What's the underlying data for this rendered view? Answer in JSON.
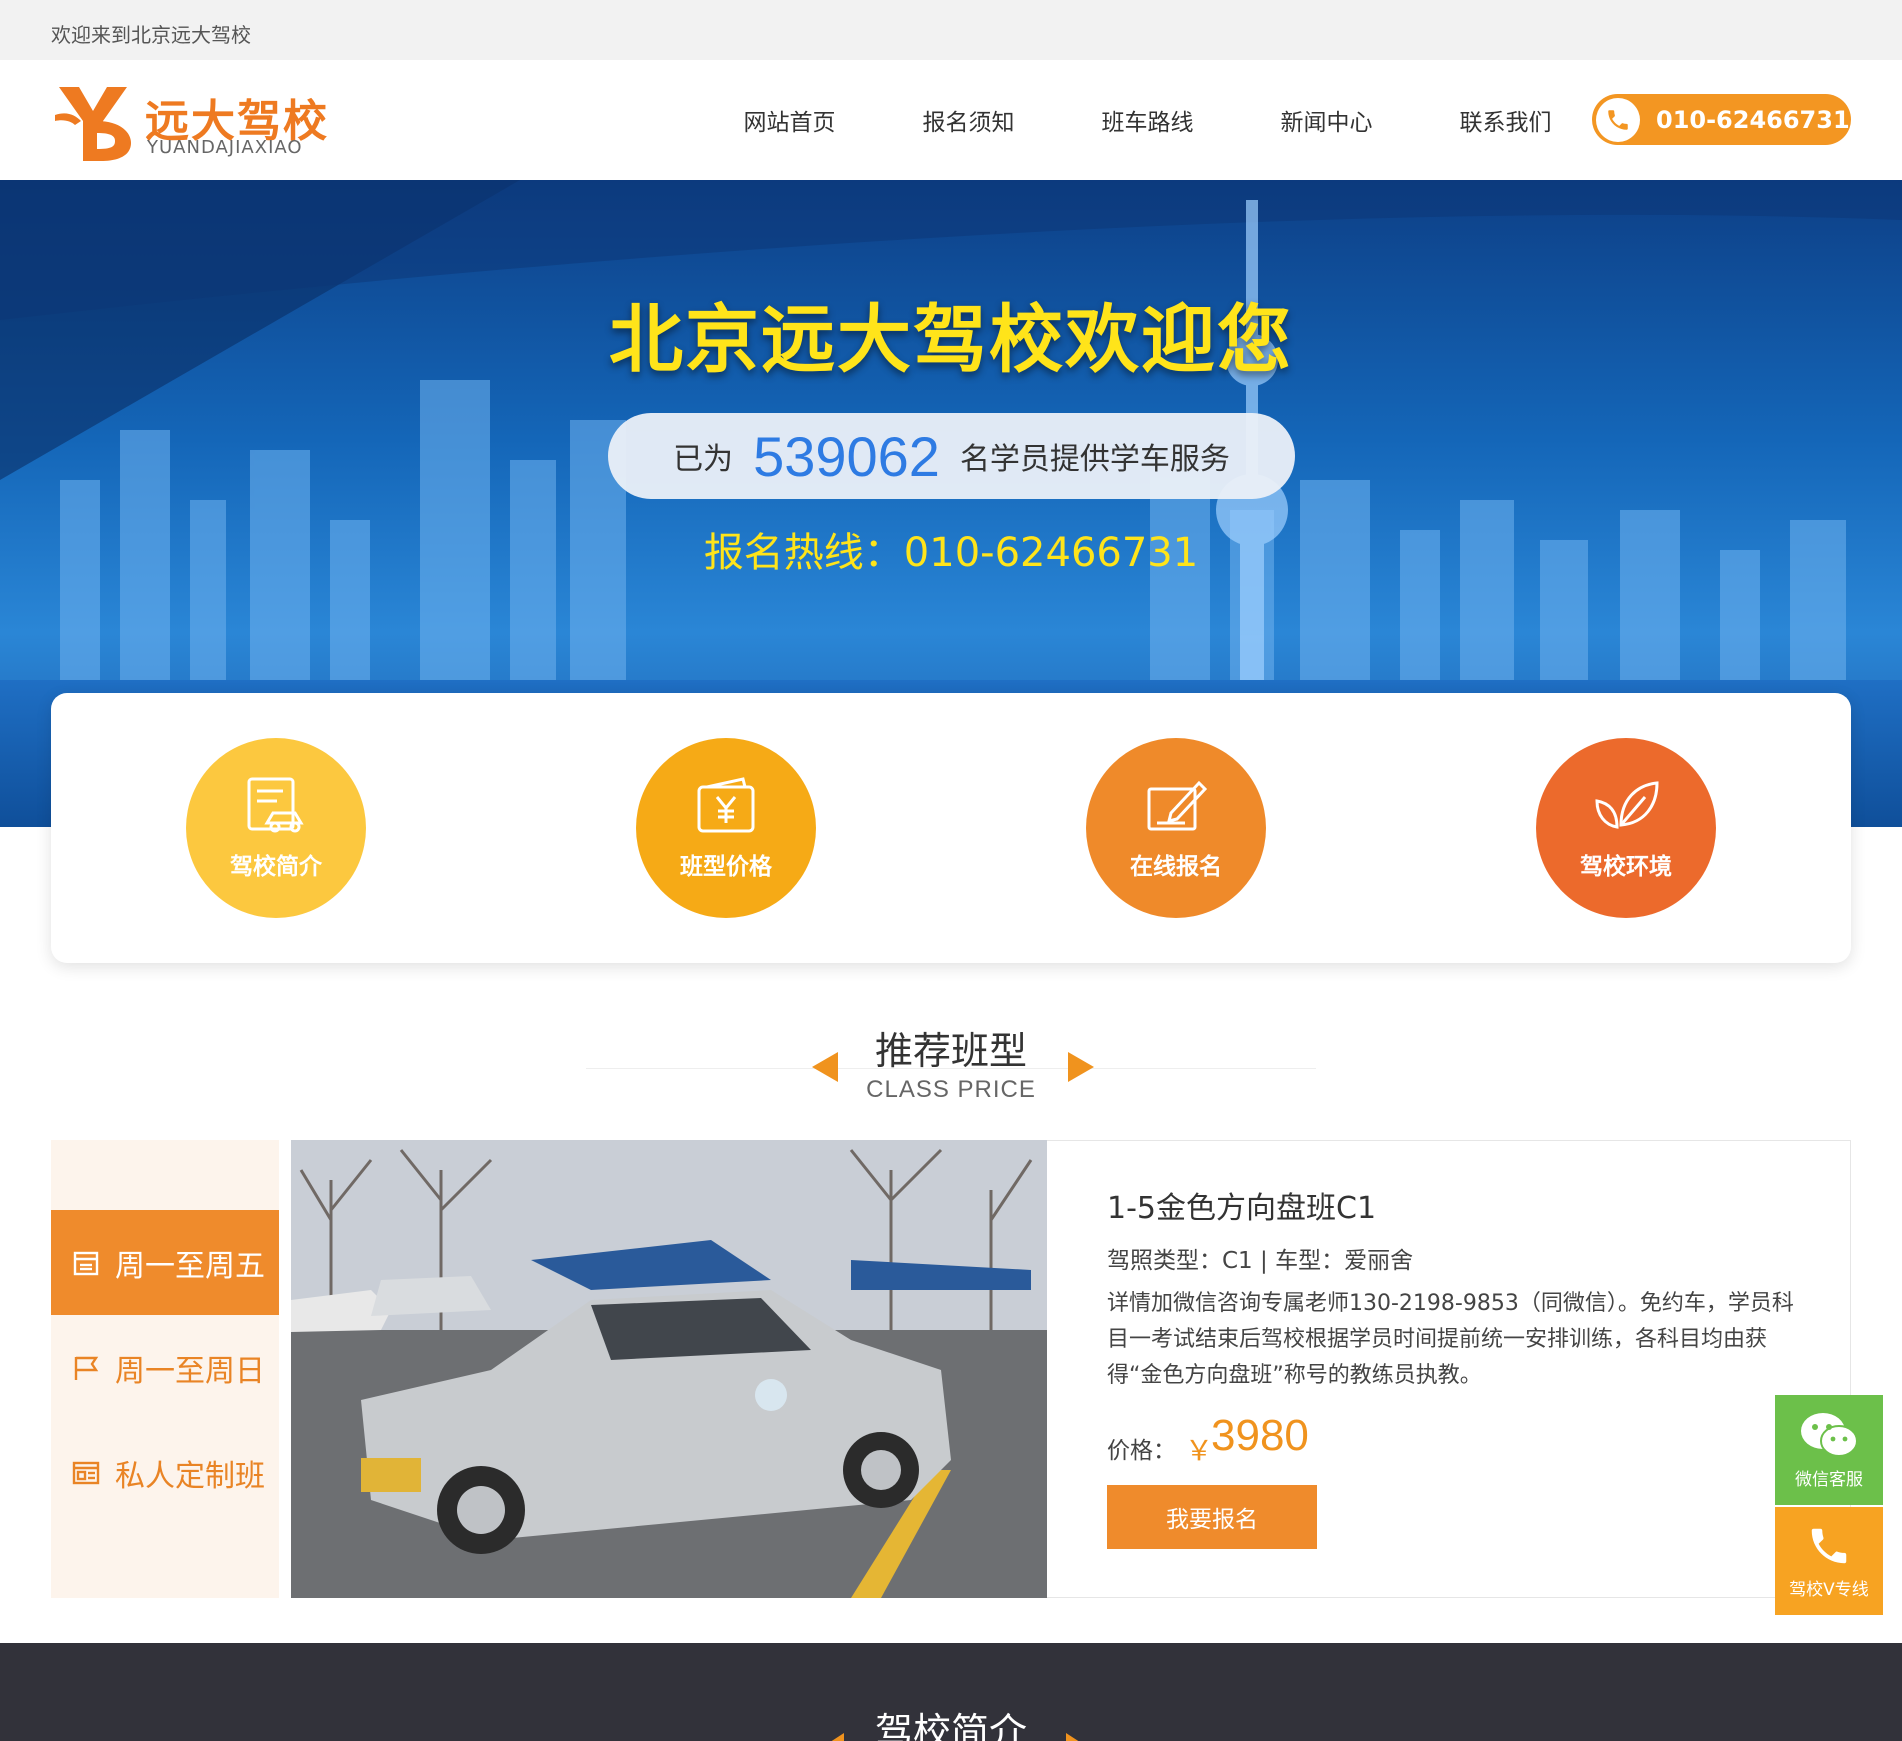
{
  "topbar": {
    "welcome": "欢迎来到北京远大驾校"
  },
  "logo": {
    "cn": "远大驾校",
    "en": "YUANDAJIAXIAO"
  },
  "nav": {
    "items": [
      "网站首页",
      "报名须知",
      "班车路线",
      "新闻中心",
      "联系我们"
    ]
  },
  "header_phone": {
    "number": "010-62466731",
    "icon": "phone-icon"
  },
  "banner": {
    "title": "北京远大驾校欢迎您",
    "counter_pre": "已为",
    "counter_value": "539062",
    "counter_post": "名学员提供学车服务",
    "hotline": "报名热线：010-62466731"
  },
  "features": [
    {
      "label": "驾校简介",
      "icon": "school-intro-icon",
      "color": "#fcc83f"
    },
    {
      "label": "班型价格",
      "icon": "price-tag-icon",
      "color": "#f6aa16"
    },
    {
      "label": "在线报名",
      "icon": "edit-form-icon",
      "color": "#ef8a2a"
    },
    {
      "label": "驾校环境",
      "icon": "leaf-icon",
      "color": "#ec6a2c"
    }
  ],
  "section": {
    "title": "推荐班型",
    "subtitle": "CLASS PRICE"
  },
  "tabs": [
    {
      "label": "周一至周五",
      "icon": "calendar-icon",
      "active": true
    },
    {
      "label": "周一至周日",
      "icon": "flag-icon",
      "active": false
    },
    {
      "label": "私人定制班",
      "icon": "id-card-icon",
      "active": false
    }
  ],
  "class_detail": {
    "name": "1-5金色方向盘班C1",
    "meta": "驾照类型：C1 | 车型：爱丽舍",
    "description": "详情加微信咨询专属老师130-2198-9853（同微信）。免约车，学员科目一考试结束后驾校根据学员时间提前统一安排训练，各科目均由获得“金色方向盘班”称号的教练员执教。",
    "price_label": "价格：",
    "currency": "￥",
    "price": "3980",
    "button": "我要报名"
  },
  "floating": {
    "wechat": "微信客服",
    "hotline": "驾校V专线"
  },
  "next_section": {
    "title": "驾校简介"
  },
  "colors": {
    "accent": "#ef8b2c",
    "banner_blue": "#1466b8",
    "highlight_yellow": "#ffe41a",
    "counter_blue": "#2e7be3"
  }
}
